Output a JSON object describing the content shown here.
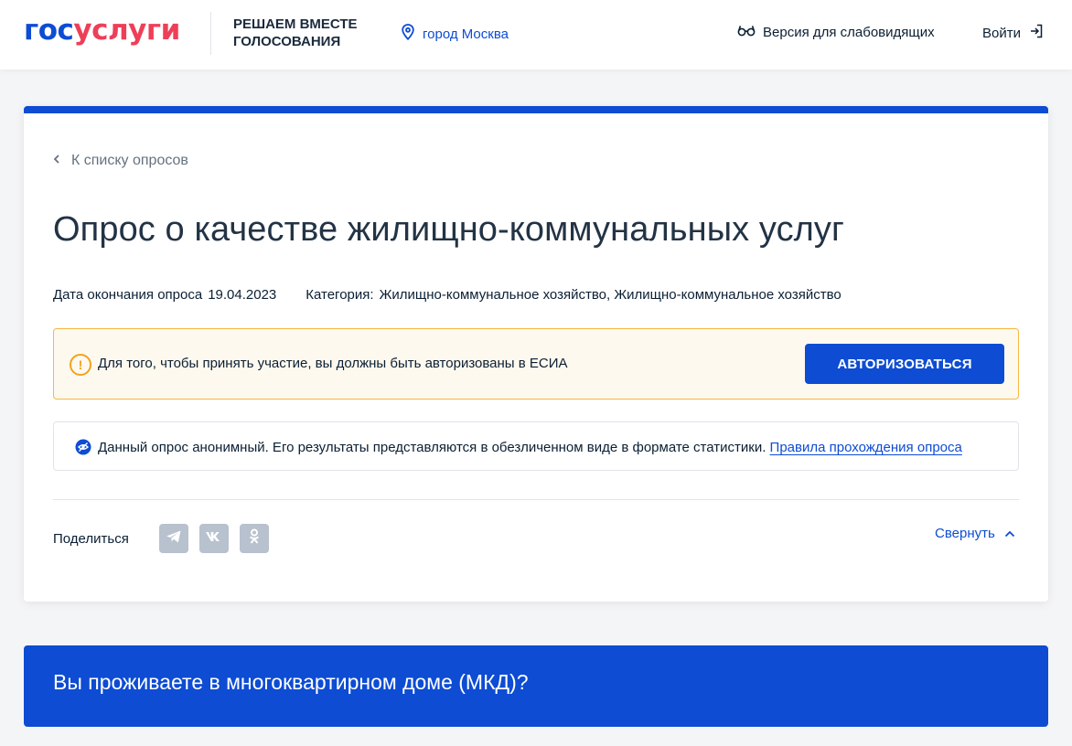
{
  "header": {
    "logo_part1": "гос",
    "logo_part2": "услуги",
    "project_line1": "РЕШАЕМ ВМЕСТЕ",
    "project_line2": "ГОЛОСОВАНИЯ",
    "city": "город Москва",
    "vision_label": "Версия для слабовидящих",
    "login_label": "Войти"
  },
  "survey": {
    "back_label": "К списку опросов",
    "title": "Опрос о качестве жилищно-коммунальных услуг",
    "end_date_label": "Дата окончания опроса",
    "end_date_value": "19.04.2023",
    "category_label": "Категория:",
    "category_value": "Жилищно-коммунальное хозяйство, Жилищно-коммунальное хозяйство",
    "alert_text": "Для того, чтобы принять участие, вы должны быть авторизованы в ЕСИА",
    "auth_button": "АВТОРИЗОВАТЬСЯ",
    "info_text": "Данный опрос анонимный. Его результаты представляются в обезличенном виде в формате статистики.",
    "info_link": "Правила прохождения опроса",
    "share_label": "Поделиться",
    "collapse_label": "Свернуть"
  },
  "question": {
    "text": "Вы проживаете в многоквартирном доме (МКД)?"
  },
  "colors": {
    "brand_blue": "#0d4cd3",
    "brand_red": "#ee3f58",
    "warning": "#f3a21c"
  }
}
